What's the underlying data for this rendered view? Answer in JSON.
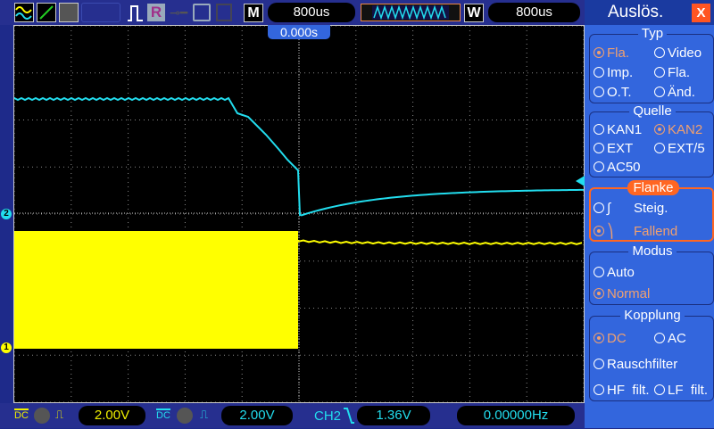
{
  "toolbar": {
    "timebase": "800us",
    "trigger_pos": "0.000s",
    "mode_label": "M",
    "window_label": "W",
    "window_time": "800us",
    "run_label": "R"
  },
  "bottom": {
    "ch1_coupling": "DC",
    "ch1_scale": "2.00V",
    "ch2_coupling": "DC",
    "ch2_scale": "2.00V",
    "trig_source": "CH2",
    "trig_level": "1.36V",
    "frequency": "0.00000Hz"
  },
  "markers": {
    "ch1": "1",
    "ch2": "2"
  },
  "panel": {
    "title": "Auslös.",
    "close": "X",
    "typ": {
      "label": "Typ",
      "options": [
        "Fla.",
        "Video",
        "Imp.",
        "Fla.",
        "O.T.",
        "Änd."
      ]
    },
    "quelle": {
      "label": "Quelle",
      "options": [
        "KAN1",
        "KAN2",
        "EXT",
        "EXT/5",
        "AC50"
      ]
    },
    "flanke": {
      "label": "Flanke",
      "options": [
        "Steig.",
        "Fallend"
      ]
    },
    "modus": {
      "label": "Modus",
      "options": [
        "Auto",
        "Normal"
      ]
    },
    "kopplung": {
      "label": "Kopplung",
      "options": [
        "DC",
        "AC",
        "Rauschfilter",
        "HF  filt.",
        "LF  filt."
      ]
    }
  },
  "colors": {
    "ch1": "#ffff00",
    "ch2": "#22ddee",
    "panel": "#3366dd",
    "accent": "#ff6622"
  }
}
